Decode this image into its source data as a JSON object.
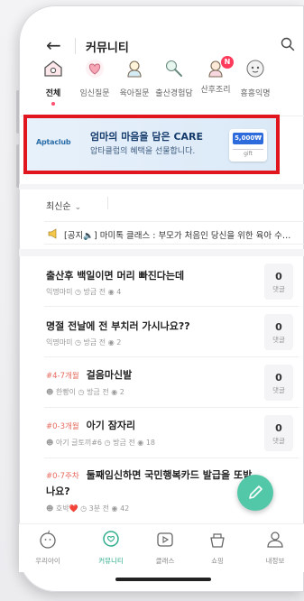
{
  "header": {
    "title": "커뮤니티",
    "back_icon": "arrow-left-icon",
    "search_icon": "search-icon"
  },
  "categories": [
    {
      "label": "전체",
      "icon": "home-icon",
      "active": true
    },
    {
      "label": "임신질문",
      "icon": "heart-icon"
    },
    {
      "label": "육아질문",
      "icon": "baby-icon"
    },
    {
      "label": "출산경험담",
      "icon": "rattle-icon"
    },
    {
      "label": "산후조리",
      "icon": "mom-icon",
      "badge": "N"
    },
    {
      "label": "흥흥익명",
      "icon": "anonymous-icon"
    }
  ],
  "banner": {
    "logo": "Aptaclub",
    "headline": "엄마의 마음을 담은 CARE",
    "subtext": "압타클럽의 혜택을 선물합니다.",
    "card_top": "5,000₩",
    "card_bottom": "gift"
  },
  "sort": {
    "label": "최신순"
  },
  "notice": {
    "text": "[공지🔈] 마미톡 클래스 : 부모가 처음인 당신을 위한 육아 수…"
  },
  "posts": [
    {
      "tag": "",
      "title": "출산후 백일이면 머리 빠진다는데",
      "author": "익명마미",
      "time": "방금 전",
      "views": "4",
      "comments": "0",
      "comments_label": "댓글"
    },
    {
      "tag": "",
      "title": "명절 전날에 전 부치러 가시나요??",
      "author": "익명마미",
      "time": "방금 전",
      "views": "2",
      "comments": "0",
      "comments_label": "댓글"
    },
    {
      "tag": "#4-7개월",
      "title": "걸음마신발",
      "author": "한빵이",
      "time": "방금 전",
      "views": "2",
      "comments": "0",
      "comments_label": "댓글"
    },
    {
      "tag": "#0-3개월",
      "title": "아기 잠자리",
      "author": "아기 글토끼#6",
      "time": "방금 전",
      "views": "18",
      "comments": "0",
      "comments_label": "댓글"
    },
    {
      "tag": "#0-7주차",
      "title": "둘째임신하면 국민행복카드 발급을 또받",
      "title2": "나요?",
      "author": "호박❤️",
      "time": "3분 전",
      "views": "42",
      "comments": "",
      "comments_label": ""
    }
  ],
  "tabs": [
    {
      "label": "우리아이",
      "icon": "baby-face-icon"
    },
    {
      "label": "커뮤니티",
      "icon": "chat-icon",
      "active": true
    },
    {
      "label": "클래스",
      "icon": "play-icon"
    },
    {
      "label": "쇼핑",
      "icon": "basket-icon"
    },
    {
      "label": "내정보",
      "icon": "person-icon"
    }
  ],
  "colors": {
    "accent": "#2fae8b",
    "highlight": "#e0151e",
    "tag": "#e86a5e",
    "fab": "#53c8a8"
  }
}
